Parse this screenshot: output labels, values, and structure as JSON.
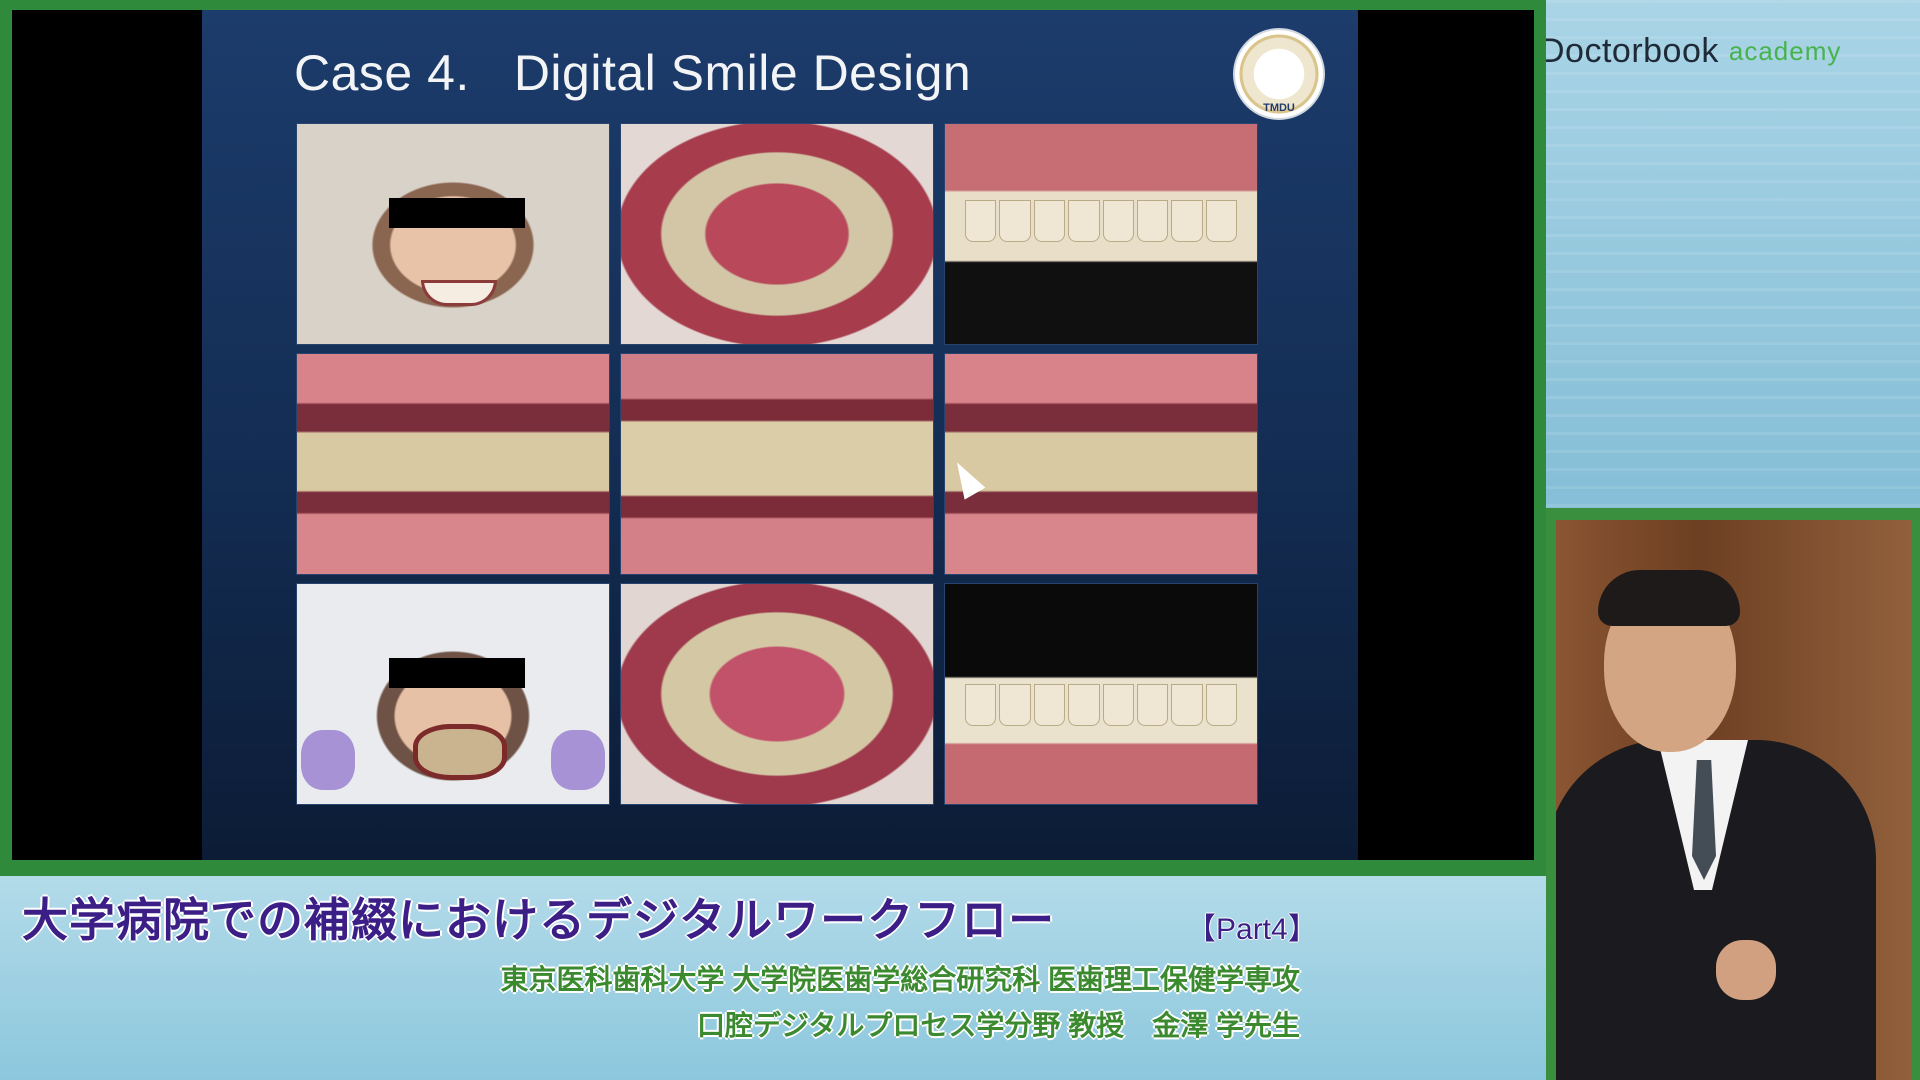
{
  "slide": {
    "case_label": "Case 4.",
    "title": "Digital Smile Design",
    "emblem_text": "TMDU"
  },
  "logo": {
    "main": "Doctorbook",
    "sub": "academy"
  },
  "lower_third": {
    "title": "大学病院での補綴におけるデジタルワークフロー",
    "part": "【Part4】",
    "affiliation": "東京医科歯科大学 大学院医歯学総合研究科 医歯理工保健学専攻",
    "department": "口腔デジタルプロセス学分野 教授",
    "speaker": "金澤 学先生"
  },
  "colors": {
    "frame_green": "#2f8a3b",
    "title_purple": "#3c1f86",
    "subtitle_green": "#3c8a2f",
    "slide_blue": "#1c3c6c"
  }
}
